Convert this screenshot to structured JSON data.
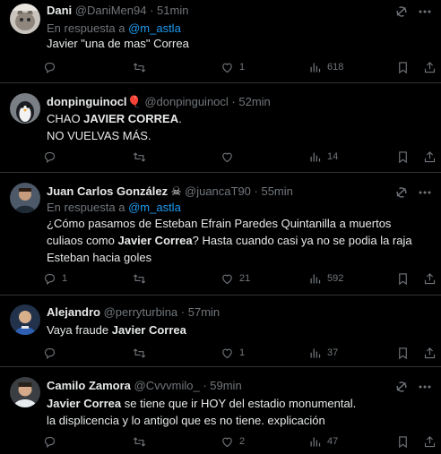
{
  "tweets": [
    {
      "name": "Dani",
      "handle": "@DaniMen94",
      "time": "· 51min",
      "reply_prefix": "En respuesta a",
      "reply_to": "@m_astla",
      "text_segments": [
        {
          "t": "Javier \"una de mas\" Correa",
          "bold": false
        }
      ],
      "replies": "",
      "retweets": "",
      "likes": "1",
      "views": "618"
    },
    {
      "name": "donpinguinocl",
      "name_badge": "🎈",
      "handle": "@donpinguinocl",
      "time": "· 52min",
      "text_segments": [
        {
          "t": "CHAO ",
          "bold": false
        },
        {
          "t": "JAVIER CORREA",
          "bold": true
        },
        {
          "t": ".\nNO VUELVAS MÁS.",
          "bold": false
        }
      ],
      "replies": "",
      "retweets": "",
      "likes": "",
      "views": "14"
    },
    {
      "name": "Juan Carlos González",
      "name_badge": "☠",
      "handle": "@juancaT90",
      "time": "· 55min",
      "reply_prefix": "En respuesta a",
      "reply_to": "@m_astla",
      "text_segments": [
        {
          "t": "¿Cómo pasamos de Esteban Efrain Paredes Quintanilla a muertos culiaos como ",
          "bold": false
        },
        {
          "t": "Javier Correa",
          "bold": true
        },
        {
          "t": "? Hasta cuando casi ya no se podia la raja Esteban hacia goles",
          "bold": false
        }
      ],
      "replies": "1",
      "retweets": "",
      "likes": "21",
      "views": "592"
    },
    {
      "name": "Alejandro",
      "handle": "@perryturbina",
      "time": "· 57min",
      "text_segments": [
        {
          "t": "Vaya fraude ",
          "bold": false
        },
        {
          "t": "Javier Correa",
          "bold": true
        }
      ],
      "replies": "",
      "retweets": "",
      "likes": "1",
      "views": "37"
    },
    {
      "name": "Camilo Zamora",
      "handle": "@Cvvvmilo_",
      "time": "· 59min",
      "text_segments": [
        {
          "t": "Javier Correa",
          "bold": true
        },
        {
          "t": " se tiene que ir HOY del estadio monumental.\nla displicencia y lo antigol que es no tiene. explicación",
          "bold": false
        }
      ],
      "replies": "",
      "retweets": "",
      "likes": "2",
      "views": "47"
    }
  ],
  "colors": {
    "background": "#000000",
    "text": "#e7e9ea",
    "muted": "#71767b",
    "link": "#1d9bf0",
    "border": "#2f3336"
  },
  "icons": {
    "grok": "grok-icon",
    "more": "more-icon",
    "reply": "reply-icon",
    "retweet": "retweet-icon",
    "like": "like-icon",
    "views": "views-icon",
    "bookmark": "bookmark-icon",
    "share": "share-icon"
  }
}
